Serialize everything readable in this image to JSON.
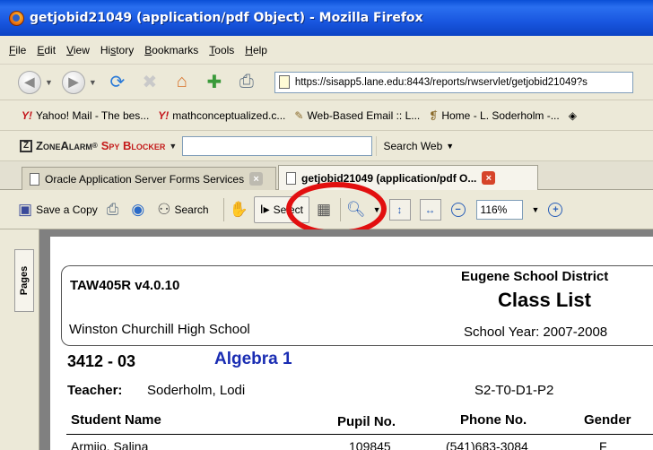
{
  "window": {
    "title": "getjobid21049 (application/pdf Object) - Mozilla Firefox"
  },
  "menu": [
    {
      "acc": "F",
      "rest": "ile"
    },
    {
      "acc": "E",
      "rest": "dit"
    },
    {
      "acc": "V",
      "rest": "iew"
    },
    {
      "pre": "Hi",
      "acc": "s",
      "rest": "tory"
    },
    {
      "acc": "B",
      "rest": "ookmarks"
    },
    {
      "acc": "T",
      "rest": "ools"
    },
    {
      "acc": "H",
      "rest": "elp"
    }
  ],
  "navbar": {
    "url": "https://sisapp5.lane.edu:8443/reports/rwservlet/getjobid21049?s"
  },
  "bookmarks": [
    {
      "icon": "yahoo-icon",
      "glyph": "Y!",
      "label": "Yahoo! Mail - The bes..."
    },
    {
      "icon": "yahoo-icon",
      "glyph": "Y!",
      "label": "mathconceptualized.c..."
    },
    {
      "icon": "email-icon",
      "glyph": "✎",
      "label": "Web-Based Email :: L..."
    },
    {
      "icon": "page-icon",
      "glyph": "❡",
      "label": "Home - L. Soderholm -..."
    }
  ],
  "zonealarm": {
    "brand": "ZoneAlarm",
    "product": "Spy Blocker",
    "search_label": "Search Web"
  },
  "tabs": [
    {
      "label": "Oracle Application Server Forms Services",
      "active": false
    },
    {
      "label": "getjobid21049 (application/pdf O...",
      "active": true
    }
  ],
  "pdf_toolbar": {
    "save_copy": "Save a Copy",
    "search": "Search",
    "select": "Select",
    "zoom": "116%"
  },
  "sidepanel": {
    "pages_tab": "Pages"
  },
  "document": {
    "report_code": "TAW405R v4.0.10",
    "district": "Eugene School District",
    "report_title": "Class List",
    "school": "Winston Churchill High School",
    "school_year": "School Year: 2007-2008",
    "section": "3412 - 03",
    "course": "Algebra 1",
    "teacher_label": "Teacher:",
    "teacher_name": "Soderholm, Lodi",
    "period_code": "S2-T0-D1-P2",
    "columns": [
      "Student Name",
      "Pupil No.",
      "Phone No.",
      "Gender"
    ],
    "rows": [
      {
        "name": "Armijo, Salina",
        "pupil": "109845",
        "phone": "(541)683-3084",
        "gender": "F"
      }
    ]
  },
  "colors": {
    "titlebar": "#1957e0",
    "chrome": "#ece9d8",
    "highlight_ring": "#e20f0f",
    "course_blue": "#1a2db3"
  }
}
